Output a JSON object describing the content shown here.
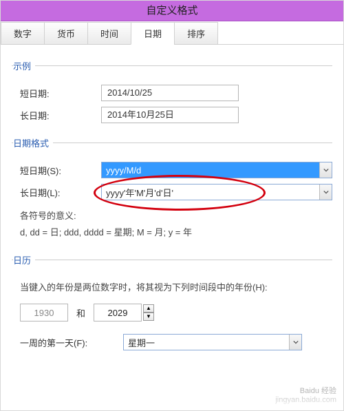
{
  "title": "自定义格式",
  "tabs": [
    "数字",
    "货币",
    "时间",
    "日期",
    "排序"
  ],
  "active_tab_index": 3,
  "sections": {
    "example": {
      "legend": "示例",
      "short_label": "短日期:",
      "short_value": "2014/10/25",
      "long_label": "长日期:",
      "long_value": "2014年10月25日"
    },
    "format": {
      "legend": "日期格式",
      "short_label": "短日期(S):",
      "short_value": "yyyy/M/d",
      "long_label": "长日期(L):",
      "long_value": "yyyy'年'M'月'd'日'",
      "hint_title": "各符号的意义:",
      "hint_body": "d, dd = 日;  ddd, dddd = 星期;  M = 月;  y = 年"
    },
    "calendar": {
      "legend": "日历",
      "two_digit_hint": "当键入的年份是两位数字时，将其视为下列时间段中的年份(H):",
      "year_from": "1930",
      "and": "和",
      "year_to": "2029",
      "first_day_label": "一周的第一天(F):",
      "first_day_value": "星期一"
    }
  },
  "watermark": {
    "brand": "Baidu 经验",
    "url": "jingyan.baidu.com"
  }
}
